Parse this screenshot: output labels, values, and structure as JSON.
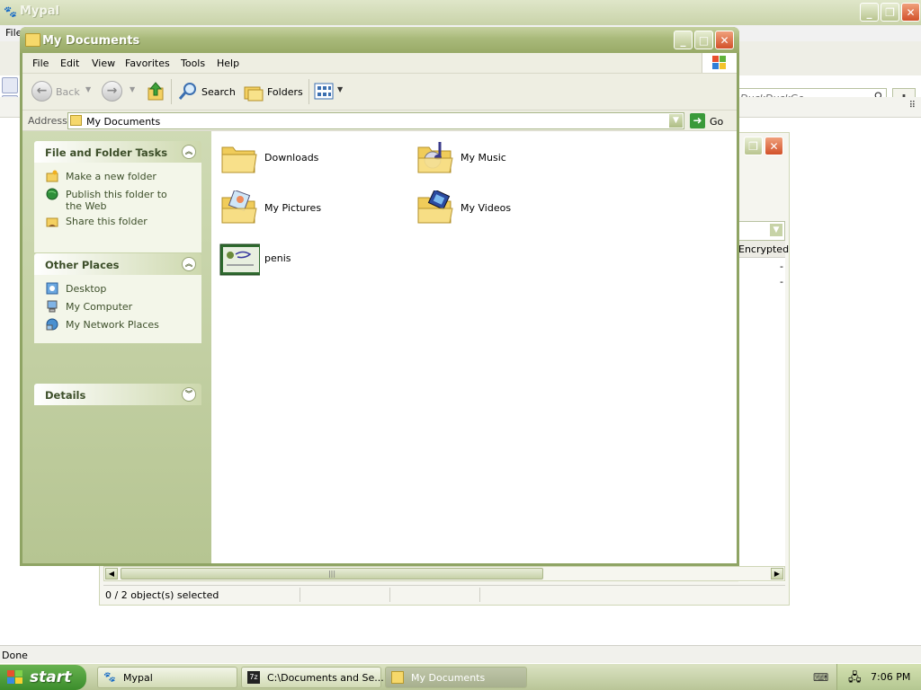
{
  "browser": {
    "title": "Mypal",
    "menu_file": "File",
    "search_placeholder": "DuckDuckGo",
    "status": "Done"
  },
  "second_window": {
    "column_header": "Encrypted",
    "rows": [
      "-",
      "-"
    ],
    "status_text": "0 / 2 object(s) selected"
  },
  "window": {
    "title": "My Documents",
    "menu": [
      "File",
      "Edit",
      "View",
      "Favorites",
      "Tools",
      "Help"
    ],
    "toolbar": {
      "back": "Back",
      "search": "Search",
      "folders": "Folders"
    },
    "address": {
      "label": "Address",
      "value": "My Documents",
      "go": "Go"
    },
    "tasks": {
      "file_folder_title": "File and Folder Tasks",
      "file_folder_items": [
        "Make a new folder",
        "Publish this folder to the Web",
        "Share this folder"
      ],
      "other_places_title": "Other Places",
      "other_places_items": [
        "Desktop",
        "My Computer",
        "My Network Places"
      ],
      "details_title": "Details"
    },
    "files": [
      {
        "name": "Downloads",
        "icon": "folder-icon"
      },
      {
        "name": "My Music",
        "icon": "music-folder-icon"
      },
      {
        "name": "My Pictures",
        "icon": "pictures-folder-icon"
      },
      {
        "name": "My Videos",
        "icon": "videos-folder-icon"
      },
      {
        "name": "penis",
        "icon": "certificate-file-icon"
      }
    ]
  },
  "taskbar": {
    "start": "start",
    "items": [
      "Mypal",
      "C:\\Documents and Se...",
      "My Documents"
    ],
    "clock": "7:06 PM"
  },
  "colors": {
    "title_bar": "#a9b97a",
    "task_pane": "#cfdab4",
    "close_button": "#d2522a",
    "start_button": "#3c8d2c"
  }
}
